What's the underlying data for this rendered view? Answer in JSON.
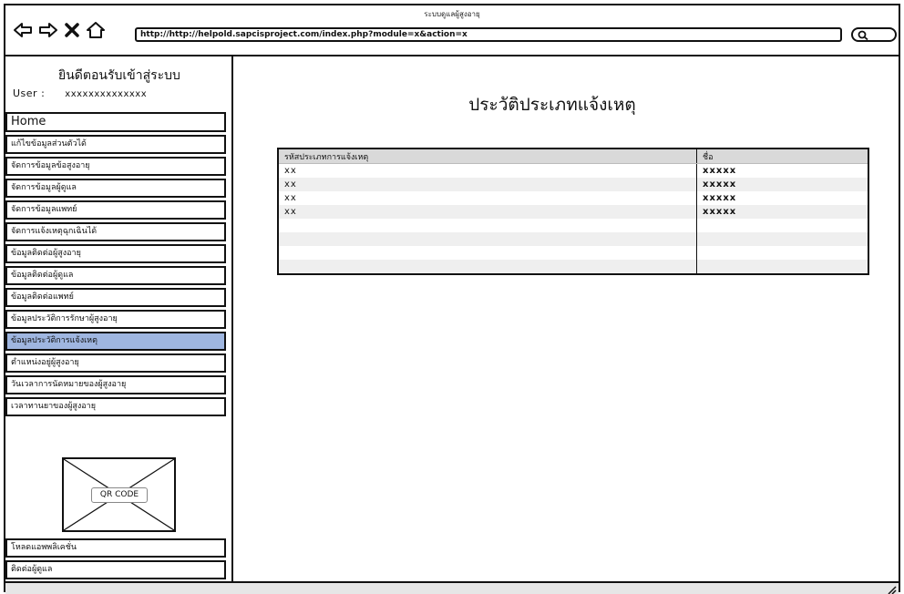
{
  "window": {
    "title": "ระบบดูแลผู้สูงอายุ"
  },
  "address_bar": {
    "url": "http://http://helpold.sapcisproject.com/index.php?module=x&action=x"
  },
  "sidebar": {
    "welcome": "ยินดีตอนรับเข้าสู่ระบบ",
    "user_label": "User :",
    "user_value": "xxxxxxxxxxxxxx",
    "items": [
      {
        "label": "Home"
      },
      {
        "label": "แก้ไขข้อมูลส่วนตัวได้"
      },
      {
        "label": "จัดการข้อมูลข้อสูงอายุ"
      },
      {
        "label": "จัดการข้อมูลผู้ดูแล"
      },
      {
        "label": "จัดการข้อมูลแพทย์"
      },
      {
        "label": "จัดการแจ้งเหตุฉุกเฉินได้"
      },
      {
        "label": "ข้อมูลติดต่อผู้สูงอายุ"
      },
      {
        "label": "ข้อมูลติดต่อผู้ดูแล"
      },
      {
        "label": "ข้อมูลติดต่อแพทย์"
      },
      {
        "label": "ข้อมูลประวัติการรักษาผู้สูงอายุ"
      },
      {
        "label": "ข้อมูลประวัติการแจ้งเหตุ"
      },
      {
        "label": "ตำแหน่งอยู่ผู้สูงอายุ"
      },
      {
        "label": "วันเวลาการนัดหมายของผู้สูงอายุ"
      },
      {
        "label": "เวลาทานยาของผู้สูงอายุ"
      }
    ],
    "active_index": 10,
    "qr_label": "QR CODE",
    "bottom_items": [
      {
        "label": "โหลดแอพพลิเคชั่น"
      },
      {
        "label": "ติดต่อผู้ดูแล"
      }
    ]
  },
  "main": {
    "title": "ประวัติประเภทแจ้งเหตุ",
    "table": {
      "headers": [
        "รหัสประเภทการแจ้งเหตุ",
        "ชื่อ"
      ],
      "rows": [
        [
          "xx",
          "xxxxx"
        ],
        [
          "xx",
          "xxxxx"
        ],
        [
          "xx",
          "xxxxx"
        ],
        [
          "xx",
          "xxxxx"
        ],
        [
          "",
          ""
        ],
        [
          "",
          ""
        ],
        [
          "",
          ""
        ],
        [
          "",
          ""
        ]
      ]
    }
  },
  "icons": {
    "back": "back-arrow-icon",
    "forward": "forward-arrow-icon",
    "close": "close-icon",
    "home": "home-icon",
    "search": "search-icon",
    "resize": "resize-grip-icon"
  }
}
